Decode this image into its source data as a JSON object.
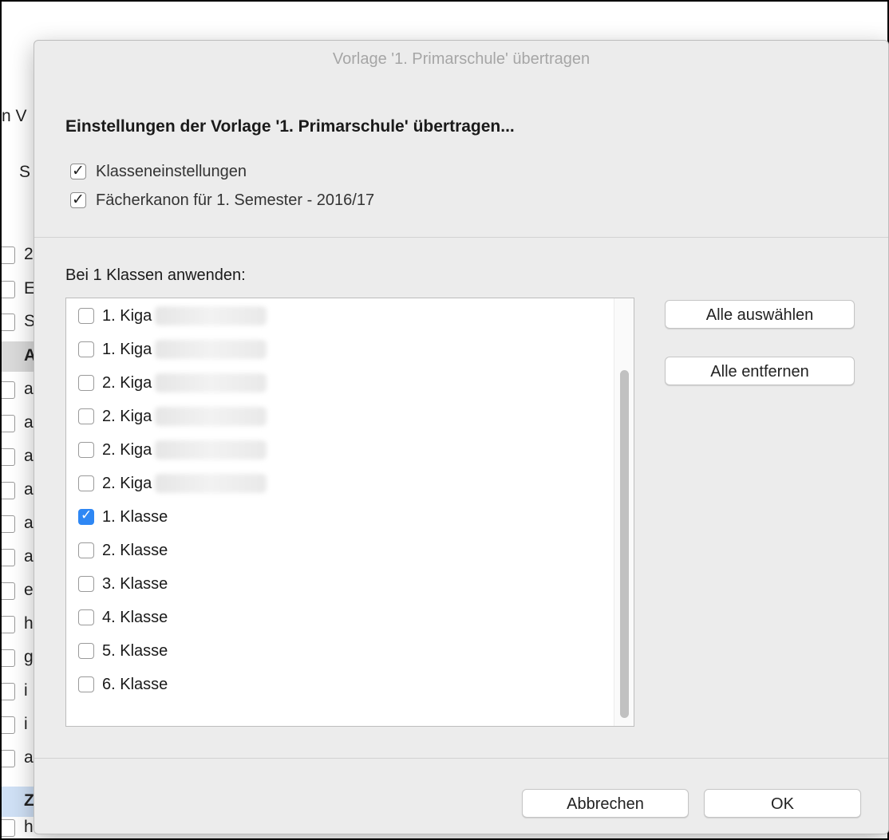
{
  "background": {
    "fragments": [
      "n V",
      "S",
      "2",
      "E",
      "S",
      "A",
      "a",
      "a",
      "a",
      "a",
      "a",
      "a",
      "e",
      "h",
      "g",
      "i",
      "i",
      "a",
      "Z",
      "h"
    ]
  },
  "dialog": {
    "title": "Vorlage '1. Primarschule' übertragen",
    "heading": "Einstellungen der Vorlage '1. Primarschule' übertragen...",
    "options": [
      {
        "label": "Klasseneinstellungen",
        "checked": true
      },
      {
        "label": "Fächerkanon für 1. Semester - 2016/17",
        "checked": true
      }
    ],
    "apply_label": "Bei 1 Klassen anwenden:",
    "classes": [
      {
        "label": "1. Kiga",
        "checked": false,
        "blurred": true
      },
      {
        "label": "1. Kiga",
        "checked": false,
        "blurred": true
      },
      {
        "label": "2. Kiga",
        "checked": false,
        "blurred": true
      },
      {
        "label": "2. Kiga",
        "checked": false,
        "blurred": true
      },
      {
        "label": "2. Kiga",
        "checked": false,
        "blurred": true
      },
      {
        "label": "2. Kiga",
        "checked": false,
        "blurred": true
      },
      {
        "label": "1. Klasse",
        "checked": true,
        "blurred": false
      },
      {
        "label": "2. Klasse",
        "checked": false,
        "blurred": false
      },
      {
        "label": "3. Klasse",
        "checked": false,
        "blurred": false
      },
      {
        "label": "4. Klasse",
        "checked": false,
        "blurred": false
      },
      {
        "label": "5. Klasse",
        "checked": false,
        "blurred": false
      },
      {
        "label": "6. Klasse",
        "checked": false,
        "blurred": false
      }
    ],
    "select_all_label": "Alle auswählen",
    "remove_all_label": "Alle entfernen",
    "cancel_label": "Abbrechen",
    "ok_label": "OK",
    "checked_color": "#2e87f4"
  }
}
